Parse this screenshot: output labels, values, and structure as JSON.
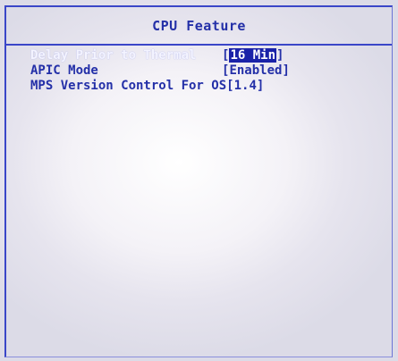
{
  "page": {
    "title": "CPU Feature"
  },
  "settings": [
    {
      "label": "Delay Prior to Thermal",
      "open_bracket": "[",
      "value": "16 Min",
      "close_bracket": "]",
      "selected": true
    },
    {
      "label": "APIC Mode",
      "open_bracket": "[",
      "value": "Enabled",
      "close_bracket": "]",
      "selected": false
    },
    {
      "label": "MPS Version Control For OS",
      "open_bracket": "[",
      "value": "1.4",
      "close_bracket": "]",
      "selected": false
    }
  ],
  "colors": {
    "text": "#2430a8",
    "highlight_bg": "#1a22a8",
    "frame": "#3a46c8"
  }
}
